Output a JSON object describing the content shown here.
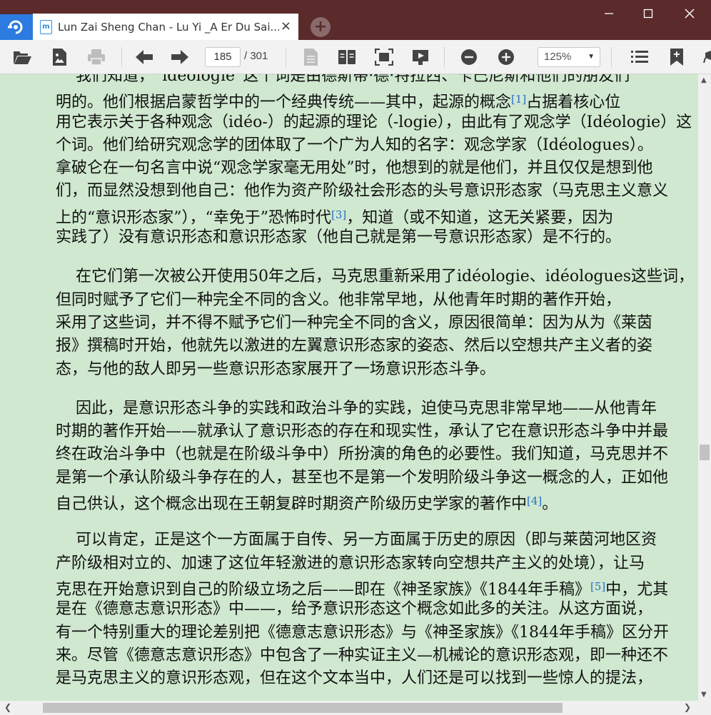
{
  "window": {
    "tab_title": "Lun Zai Sheng Chan - Lu Yi _A Er Du Sai....",
    "tab_close": "×",
    "new_tab": "+",
    "minimize": "—",
    "maximize": "☐",
    "close": "✕"
  },
  "toolbar": {
    "current_page": "185",
    "total_pages": "/ 301",
    "zoom": "125%",
    "zoom_arrow": "▼"
  },
  "document": {
    "paragraphs": [
      {
        "lines": [
          {
            "text": "    我们知道，“idéologie”这个词是由德斯蒂·德·特拉西、卡巴尼斯和他们的朋友们"
          },
          {
            "text": "明的。他们根据启蒙哲学中的一个经典传统——其中，起源的概念",
            "ref": "[1]",
            "after": "占据着核心位"
          },
          {
            "text": "用它表示关于各种观念（idéo-）的起源的理论（-logie），由此有了观念学（Idéologie）这"
          },
          {
            "text": "个词。他们给研究观念学的团体取了一个广为人知的名字：观念学家（Idéologues）。"
          },
          {
            "text": "拿破仑在一句名言中说“观念学家毫无用处”时，他想到的就是他们，并且仅仅是想到他"
          },
          {
            "text": "们，而显然没想到他自己：他作为资产阶级社会形态的头号意识形态家（马克思主义意义"
          },
          {
            "text": "上的“意识形态家”），“幸免于”恐怖时代",
            "ref": "[3]",
            "after": "，知道（或不知道，这无关紧要，因为"
          },
          {
            "text": "实践了）没有意识形态和意识形态家（他自己就是第一号意识形态家）是不行的。"
          }
        ]
      },
      {
        "lines": [
          {
            "text": "    在它们第一次被公开使用50年之后，马克思重新采用了idéologie、idéologues这些词，"
          },
          {
            "text": "但同时赋予了它们一种完全不同的含义。他非常早地，从他青年时期的著作开始，"
          },
          {
            "text": "采用了这些词，并不得不赋予它们一种完全不同的含义，原因很简单：因为从为《莱茵"
          },
          {
            "text": "报》撰稿时开始，他就先以激进的左翼意识形态家的姿态、然后以空想共产主义者的姿"
          },
          {
            "text": "态，与他的敌人即另一些意识形态家展开了一场意识形态斗争。"
          }
        ]
      },
      {
        "lines": [
          {
            "text": "    因此，是意识形态斗争的实践和政治斗争的实践，迫使马克思非常早地——从他青年"
          },
          {
            "text": "时期的著作开始——就承认了意识形态的存在和现实性，承认了它在意识形态斗争中并最"
          },
          {
            "text": "终在政治斗争中（也就是在阶级斗争中）所扮演的角色的必要性。我们知道，马克思并不"
          },
          {
            "text": "是第一个承认阶级斗争存在的人，甚至也不是第一个发明阶级斗争这一概念的人，正如他"
          },
          {
            "text": "自己供认，这个概念出现在王朝复辟时期资产阶级历史学家的著作中",
            "ref": "[4]",
            "after": "。"
          }
        ]
      },
      {
        "lines": [
          {
            "text": "    可以肯定，正是这个一方面属于自传、另一方面属于历史的原因（即与莱茵河地区资"
          },
          {
            "text": "产阶级相对立的、加速了这位年轻激进的意识形态家转向空想共产主义的处境），让马"
          },
          {
            "text": "克思在开始意识到自己的阶级立场之后——即在《神圣家族》《1844年手稿》",
            "ref": "[5]",
            "after": "中，尤其"
          },
          {
            "text": "是在《德意志意识形态》中——，给予意识形态这个概念如此多的关注。从这方面说，"
          },
          {
            "text": "有一个特别重大的理论差别把《德意志意识形态》与《神圣家族》《1844年手稿》区分开"
          },
          {
            "text": "来。尽管《德意志意识形态》中包含了一种实证主义—机械论的意识形态观，即一种还不"
          },
          {
            "text": "是马克思主义的意识形态观，但在这个文本当中，人们还是可以找到一些惊人的提法，"
          }
        ]
      }
    ]
  }
}
